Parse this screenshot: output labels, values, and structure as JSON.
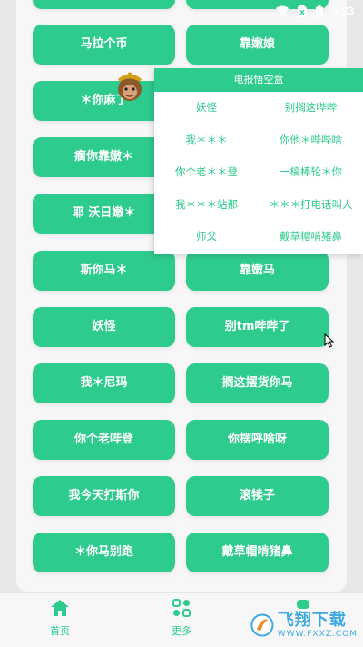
{
  "status_bar": {
    "time": "5:23"
  },
  "buttons": [
    [
      "马拉个币",
      "靠嫩娘"
    ],
    [
      "＊你麻了",
      ""
    ],
    [
      "瘸你靠嫩＊",
      ""
    ],
    [
      "耶 沃日嫩＊",
      ""
    ],
    [
      "斯你马＊",
      "靠嫩马"
    ],
    [
      "妖怪",
      "别tm哔哔了"
    ],
    [
      "我＊尼玛",
      "搁这摆货你马"
    ],
    [
      "你个老哔登",
      "你摆呼啥呀"
    ],
    [
      "我今天打斯你",
      "滚犊子"
    ],
    [
      "＊你马别跑",
      "戴草帽啃猪鼻"
    ]
  ],
  "popup": {
    "title": "电报悟空盒",
    "items": [
      "妖怪",
      "别搁这哔哔",
      "我＊＊＊",
      "你他＊哔哔啥",
      "你个老＊＊登",
      "一槁棒轮＊你",
      "我＊＊＊站那",
      "＊＊＊打电话叫人",
      "师父",
      "戴草帽啃猪鼻"
    ]
  },
  "tabbar": {
    "home_label": "首页",
    "more_label": "更多"
  },
  "watermark": {
    "main": "飞翔下载",
    "sub": "WWW.FXXZ.COM"
  },
  "colors": {
    "accent": "#2ecb8e",
    "background": "#f7f7f7"
  }
}
